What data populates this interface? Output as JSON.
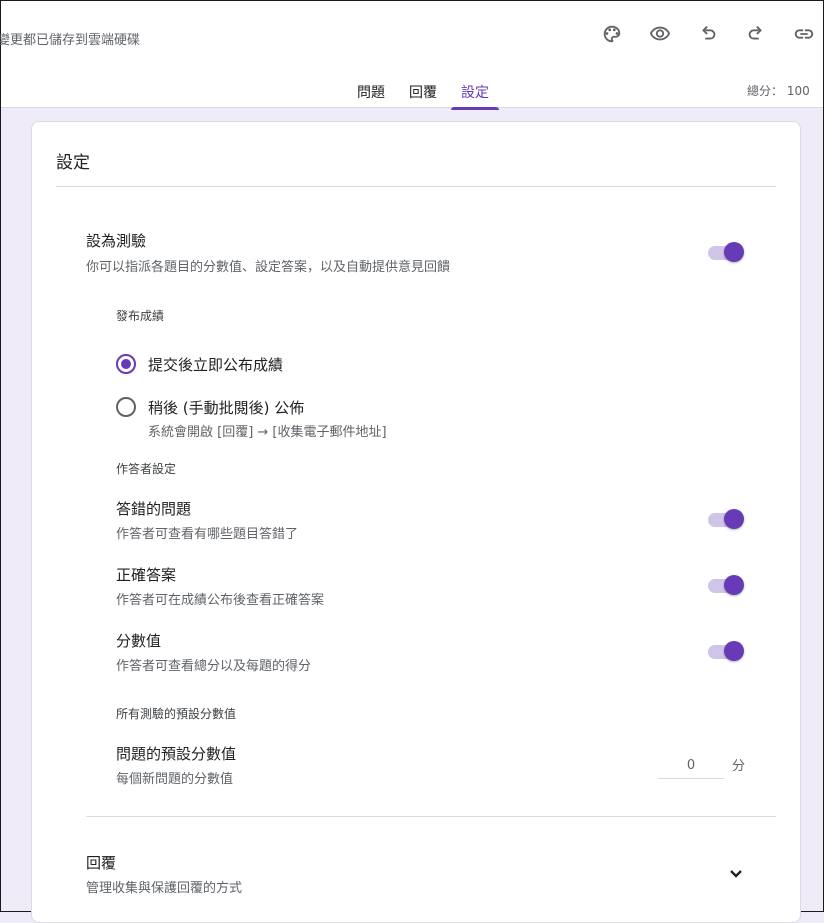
{
  "header": {
    "saved_status": "變更都已儲存到雲端硬碟",
    "icons": [
      "palette-icon",
      "preview-eye-icon",
      "undo-icon",
      "redo-icon",
      "link-icon"
    ],
    "tabs": [
      {
        "label": "問題",
        "active": false
      },
      {
        "label": "回覆",
        "active": false
      },
      {
        "label": "設定",
        "active": true
      }
    ],
    "total_points": "總分： 100"
  },
  "colors": {
    "accent": "#673ab7",
    "toggle_track": "#d1c4e9",
    "page_background": "#f0ebf8"
  },
  "settings": {
    "title": "設定",
    "quiz": {
      "title": "設為測驗",
      "description": "你可以指派各題目的分數值、設定答案，以及自動提供意見回饋",
      "enabled": true
    },
    "release_grade": {
      "label": "發布成績",
      "options": [
        {
          "label": "提交後立即公布成績",
          "checked": true
        },
        {
          "label": "稍後 (手動批閱後) 公佈",
          "checked": false,
          "note": "系統會開啟 [回覆] → [收集電子郵件地址]"
        }
      ]
    },
    "respondent": {
      "label": "作答者設定",
      "items": [
        {
          "title": "答錯的問題",
          "description": "作答者可查看有哪些題目答錯了",
          "enabled": true
        },
        {
          "title": "正確答案",
          "description": "作答者可在成績公布後查看正確答案",
          "enabled": true
        },
        {
          "title": "分數值",
          "description": "作答者可查看總分以及每題的得分",
          "enabled": true
        }
      ]
    },
    "defaults": {
      "label": "所有測驗的預設分數值",
      "title": "問題的預設分數值",
      "description": "每個新問題的分數值",
      "value": "0",
      "unit": "分"
    },
    "responses": {
      "title": "回覆",
      "description": "管理收集與保護回覆的方式"
    }
  }
}
